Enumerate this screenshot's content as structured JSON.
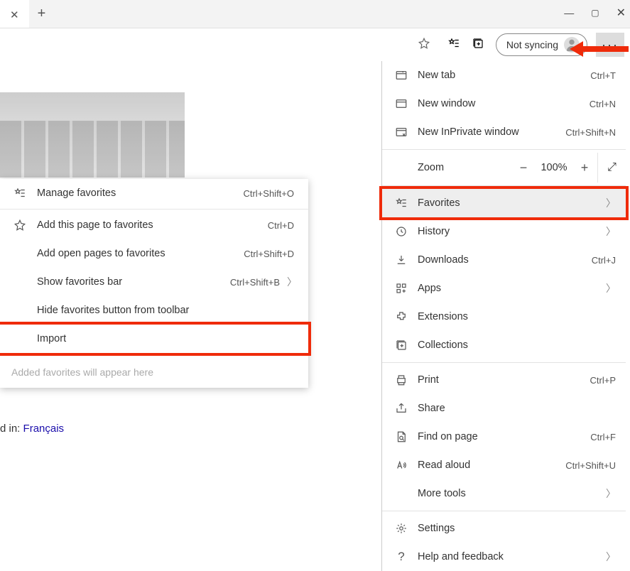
{
  "toolbar": {
    "sync_label": "Not syncing"
  },
  "menu": {
    "new_tab": "New tab",
    "new_tab_sc": "Ctrl+T",
    "new_window": "New window",
    "new_window_sc": "Ctrl+N",
    "new_inprivate": "New InPrivate window",
    "new_inprivate_sc": "Ctrl+Shift+N",
    "zoom_label": "Zoom",
    "zoom_value": "100%",
    "favorites": "Favorites",
    "history": "History",
    "downloads": "Downloads",
    "downloads_sc": "Ctrl+J",
    "apps": "Apps",
    "extensions": "Extensions",
    "collections": "Collections",
    "print": "Print",
    "print_sc": "Ctrl+P",
    "share": "Share",
    "find": "Find on page",
    "find_sc": "Ctrl+F",
    "read": "Read aloud",
    "read_sc": "Ctrl+Shift+U",
    "more_tools": "More tools",
    "settings": "Settings",
    "help": "Help and feedback"
  },
  "submenu": {
    "manage": "Manage favorites",
    "manage_sc": "Ctrl+Shift+O",
    "add_page": "Add this page to favorites",
    "add_page_sc": "Ctrl+D",
    "add_open": "Add open pages to favorites",
    "add_open_sc": "Ctrl+Shift+D",
    "show_bar": "Show favorites bar",
    "show_bar_sc": "Ctrl+Shift+B",
    "hide_button": "Hide favorites button from toolbar",
    "import": "Import",
    "placeholder": "Added favorites will appear here"
  },
  "page": {
    "offered_in": "d in:  ",
    "language": "Français"
  }
}
